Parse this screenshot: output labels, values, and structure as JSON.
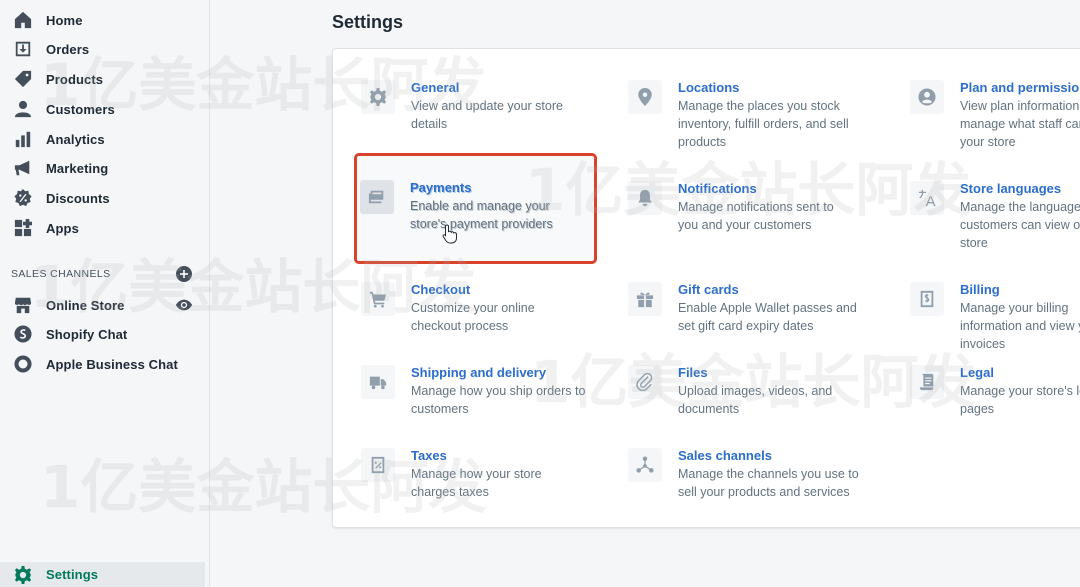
{
  "sidebar": {
    "items": [
      {
        "label": "Home",
        "icon": "home-icon"
      },
      {
        "label": "Orders",
        "icon": "orders-icon"
      },
      {
        "label": "Products",
        "icon": "products-icon"
      },
      {
        "label": "Customers",
        "icon": "customers-icon"
      },
      {
        "label": "Analytics",
        "icon": "analytics-icon"
      },
      {
        "label": "Marketing",
        "icon": "marketing-icon"
      },
      {
        "label": "Discounts",
        "icon": "discounts-icon"
      },
      {
        "label": "Apps",
        "icon": "apps-icon"
      }
    ],
    "sales_channels_title": "SALES CHANNELS",
    "channels": [
      {
        "label": "Online Store",
        "icon": "store-icon"
      },
      {
        "label": "Shopify Chat",
        "icon": "shopify-chat-icon"
      },
      {
        "label": "Apple Business Chat",
        "icon": "apple-business-chat-icon"
      }
    ],
    "settings_label": "Settings"
  },
  "page": {
    "title": "Settings"
  },
  "settings": [
    {
      "title": "General",
      "desc": "View and update your store details",
      "icon": "gear-icon"
    },
    {
      "title": "Locations",
      "desc": "Manage the places you stock inventory, fulfill orders, and sell products",
      "icon": "location-pin-icon"
    },
    {
      "title": "Plan and permissions",
      "desc": "View plan information and manage what staff can do in your store",
      "icon": "account-icon"
    },
    {
      "title": "Payments",
      "desc": "Enable and manage your store's payment providers",
      "icon": "payment-card-icon"
    },
    {
      "title": "Notifications",
      "desc": "Manage notifications sent to you and your customers",
      "icon": "bell-icon"
    },
    {
      "title": "Store languages",
      "desc": "Manage the languages customers can view on your store",
      "icon": "translate-icon"
    },
    {
      "title": "Checkout",
      "desc": "Customize your online checkout process",
      "icon": "cart-icon"
    },
    {
      "title": "Gift cards",
      "desc": "Enable Apple Wallet passes and set gift card expiry dates",
      "icon": "gift-icon"
    },
    {
      "title": "Billing",
      "desc": "Manage your billing information and view your invoices",
      "icon": "billing-icon"
    },
    {
      "title": "Shipping and delivery",
      "desc": "Manage how you ship orders to customers",
      "icon": "truck-icon"
    },
    {
      "title": "Files",
      "desc": "Upload images, videos, and documents",
      "icon": "paperclip-icon"
    },
    {
      "title": "Legal",
      "desc": "Manage your store's legal pages",
      "icon": "legal-icon"
    },
    {
      "title": "Taxes",
      "desc": "Manage how your store charges taxes",
      "icon": "taxes-icon"
    },
    {
      "title": "Sales channels",
      "desc": "Manage the channels you use to sell your products and services",
      "icon": "sales-channels-icon"
    }
  ],
  "watermark": "1亿美金站长阿发",
  "colors": {
    "accent": "#2c6ecb",
    "highlight": "#d9422b",
    "active": "#007a5c"
  }
}
